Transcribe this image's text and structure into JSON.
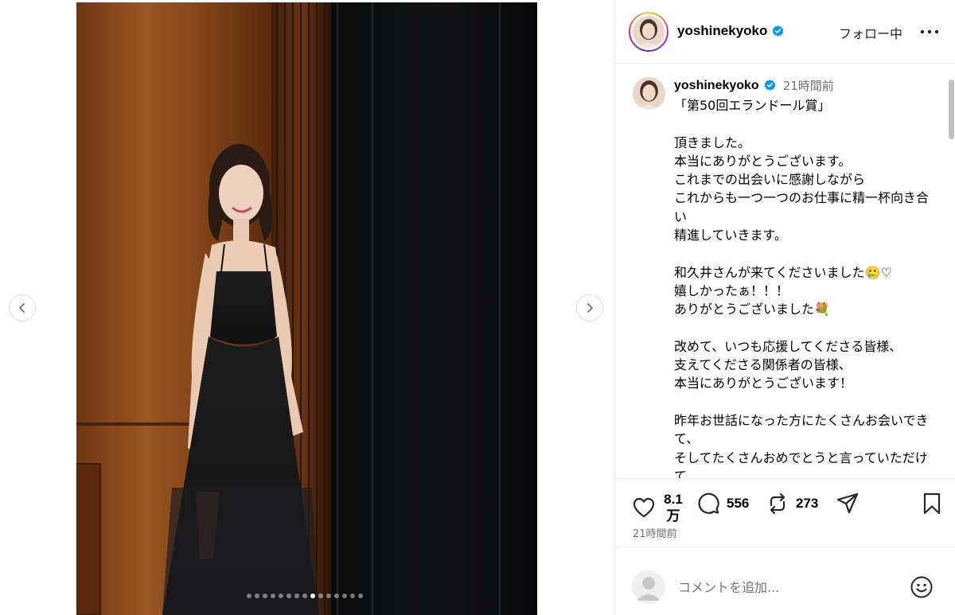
{
  "post": {
    "photo_index": 9,
    "photo_count": 15
  },
  "header": {
    "username": "yoshinekyoko",
    "follow_label": "フォロー中",
    "more_label": "その他"
  },
  "caption": {
    "username": "yoshinekyoko",
    "time": "21時間前",
    "text": "「第50回エランドール賞」\n\n頂きました。\n本当にありがとうございます。\nこれまでの出会いに感謝しながら\nこれからも一つ一つのお仕事に精一杯向き合い\n精進していきます。\n\n和久井さんが来てくださいました🥲♡\n嬉しかったぁ！！！\nありがとうございました💐\n\n改めて、いつも応援してくださる皆様、\n支えてくださる関係者の皆様、\n本当にありがとうございます！\n\n昨年お世話になった方にたくさんお会いできて、\nそしてたくさんおめでとうと言っていただけて"
  },
  "actions": {
    "likes": "8.1\n万",
    "comments": "556",
    "reposts": "273",
    "time": "21時間前"
  },
  "comment": {
    "placeholder": "コメントを追加..."
  },
  "icons": {
    "verified": "verified-badge-icon",
    "like": "heart-icon",
    "comment": "speech-bubble-icon",
    "repost": "repost-icon",
    "share": "paper-plane-icon",
    "save": "bookmark-icon",
    "emoji": "smiley-icon",
    "prev": "chevron-left-icon",
    "next": "chevron-right-icon",
    "more": "more-dots-icon"
  },
  "colors": {
    "verified": "#0095f6",
    "secondary_text": "#737373",
    "border": "#efefef"
  }
}
